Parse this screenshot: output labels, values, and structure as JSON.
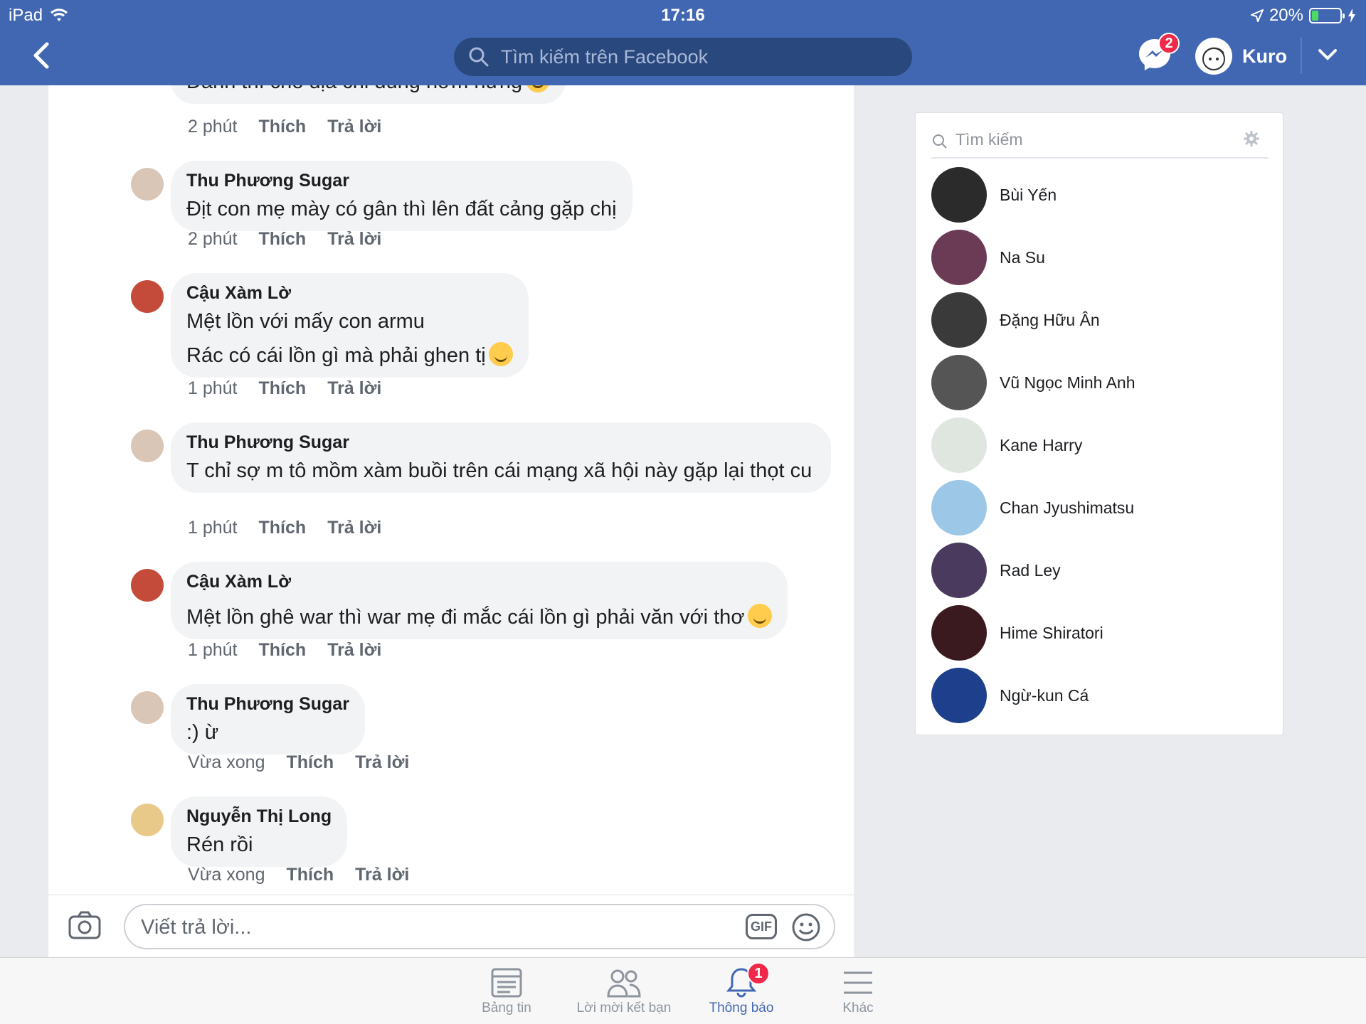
{
  "status": {
    "device": "iPad",
    "time": "17:16",
    "battery": "20%"
  },
  "header": {
    "search_placeholder": "Tìm kiếm trên Facebook",
    "messenger_badge": "2",
    "user_name": "Kuro"
  },
  "comments": [
    {
      "author": "",
      "text": "Đánh thì cho địa chỉ đúng hơm hứng",
      "time": "2 phút",
      "like": "Thích",
      "reply": "Trả lời"
    },
    {
      "author": "Thu Phương Sugar",
      "text": "Địt con mẹ mày có gân thì lên đất cảng gặp chị",
      "time": "2 phút",
      "like": "Thích",
      "reply": "Trả lời"
    },
    {
      "author": "Cậu Xàm Lờ",
      "text": "Mệt lồn với mấy con armu",
      "text2": "Rác có cái lồn gì mà phải ghen tị",
      "time": "1 phút",
      "like": "Thích",
      "reply": "Trả lời"
    },
    {
      "author": "Thu Phương Sugar",
      "text": "T chỉ sợ m tô mồm xàm buồi trên cái mạng xã hội này gặp lại thọt cu",
      "time": "1 phút",
      "like": "Thích",
      "reply": "Trả lời"
    },
    {
      "author": "Cậu Xàm Lờ",
      "text": "Mệt lồn ghê war thì war mẹ đi mắc cái lồn gì phải văn với thơ",
      "time": "1 phút",
      "like": "Thích",
      "reply": "Trả lời"
    },
    {
      "author": "Thu Phương Sugar",
      "text": ":) ừ",
      "time": "Vừa xong",
      "like": "Thích",
      "reply": "Trả lời"
    },
    {
      "author": "Nguyễn Thị Long",
      "text": "Rén rồi",
      "time": "Vừa xong",
      "like": "Thích",
      "reply": "Trả lời"
    }
  ],
  "composer": {
    "placeholder": "Viết trả lời...",
    "gif_label": "GIF"
  },
  "sidebar": {
    "search_placeholder": "Tìm kiếm",
    "contacts": [
      {
        "name": "Bùi Yến",
        "color": "#2b2b2b"
      },
      {
        "name": "Na Su",
        "color": "#6b3b55"
      },
      {
        "name": "Đặng Hữu Ân",
        "color": "#3a3a3a"
      },
      {
        "name": "Vũ Ngọc Minh Anh",
        "color": "#555555"
      },
      {
        "name": "Kane Harry",
        "color": "#dfe6df"
      },
      {
        "name": "Chan Jyushimatsu",
        "color": "#9cc7e6"
      },
      {
        "name": "Rad Ley",
        "color": "#4a3b5e"
      },
      {
        "name": "Hime Shiratori",
        "color": "#3b1a1f"
      },
      {
        "name": "Ngừ-kun Cá",
        "color": "#1d3f8c"
      }
    ]
  },
  "tabs": [
    {
      "label": "Bảng tin"
    },
    {
      "label": "Lời mời kết bạn"
    },
    {
      "label": "Thông báo",
      "badge": "1"
    },
    {
      "label": "Khác"
    }
  ],
  "colors": {
    "brand": "#4267b2",
    "badge": "#f02849",
    "bubble": "#f2f3f5"
  }
}
